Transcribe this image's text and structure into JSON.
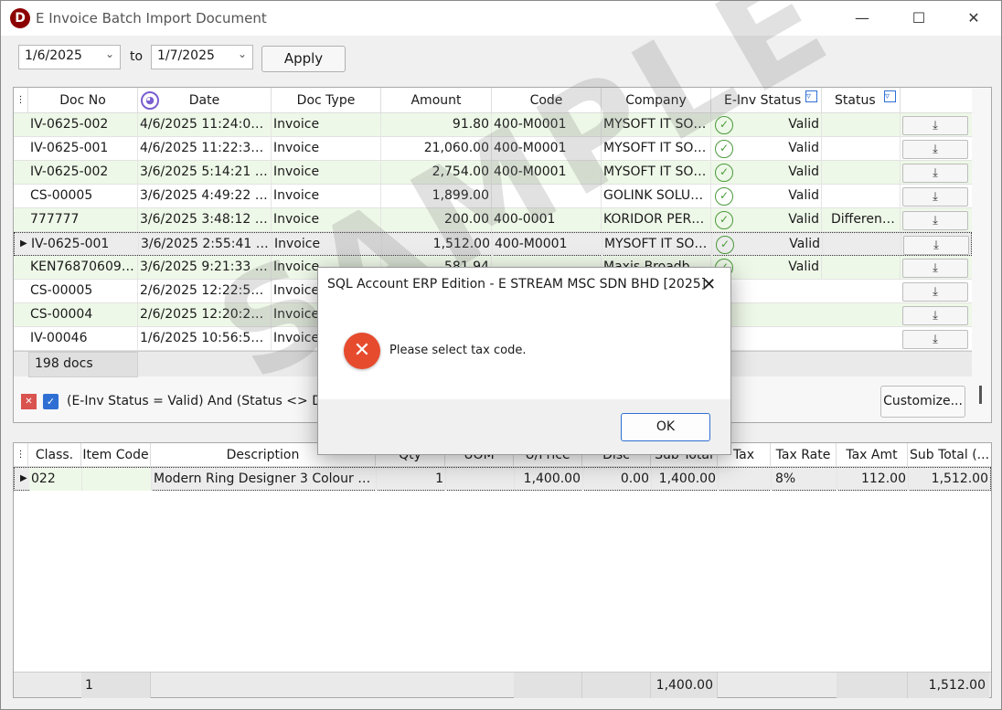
{
  "window": {
    "title": "E Invoice Batch Import Document",
    "app_letter": "D"
  },
  "toolbar": {
    "from_date": "1/6/2025",
    "to_label": "to",
    "to_date": "1/7/2025",
    "apply_label": "Apply"
  },
  "main_grid": {
    "columns": [
      "Doc No",
      "Date",
      "Doc Type",
      "Amount",
      "Code",
      "Company",
      "E-Inv Status",
      "Status"
    ],
    "rows": [
      {
        "doc_no": "IV-0625-002",
        "date": "4/6/2025 11:24:08 A...",
        "doc_type": "Invoice",
        "amount": "91.80",
        "code": "400-M0001",
        "company": "MYSOFT IT SOL...",
        "einv": "Valid",
        "status": ""
      },
      {
        "doc_no": "IV-0625-001",
        "date": "4/6/2025 11:22:32 A...",
        "doc_type": "Invoice",
        "amount": "21,060.00",
        "code": "400-M0001",
        "company": "MYSOFT IT SOL...",
        "einv": "Valid",
        "status": ""
      },
      {
        "doc_no": "IV-0625-002",
        "date": "3/6/2025 5:14:21 PM",
        "doc_type": "Invoice",
        "amount": "2,754.00",
        "code": "400-M0001",
        "company": "MYSOFT IT SOL...",
        "einv": "Valid",
        "status": ""
      },
      {
        "doc_no": "CS-00005",
        "date": "3/6/2025 4:49:22 PM",
        "doc_type": "Invoice",
        "amount": "1,899.00",
        "code": "",
        "company": "GOLINK SOLUTI...",
        "einv": "Valid",
        "status": ""
      },
      {
        "doc_no": "777777",
        "date": "3/6/2025 3:48:12 PM",
        "doc_type": "Invoice",
        "amount": "200.00",
        "code": "400-0001",
        "company": "KORIDOR PERK...",
        "einv": "Valid",
        "status": "Different ..."
      },
      {
        "doc_no": "IV-0625-001",
        "date": "3/6/2025 2:55:41 PM",
        "doc_type": "Invoice",
        "amount": "1,512.00",
        "code": "400-M0001",
        "company": "MYSOFT IT SOL...",
        "einv": "Valid",
        "status": ""
      },
      {
        "doc_no": "KEN768706098...",
        "date": "3/6/2025 9:21:33 AM",
        "doc_type": "Invoice",
        "amount": "581.94",
        "code": "",
        "company": "Maxis Broadba...",
        "einv": "Valid",
        "status": ""
      },
      {
        "doc_no": "CS-00005",
        "date": "2/6/2025 12:22:50 A...",
        "doc_type": "Invoice",
        "amount": "",
        "code": "",
        "company": "",
        "einv": "",
        "status": ""
      },
      {
        "doc_no": "CS-00004",
        "date": "2/6/2025 12:20:29 A...",
        "doc_type": "Invoice",
        "amount": "",
        "code": "",
        "company": "",
        "einv": "",
        "status": ""
      },
      {
        "doc_no": "IV-00046",
        "date": "1/6/2025 10:56:54 P...",
        "doc_type": "Invoice",
        "amount": "",
        "code": "",
        "company": "",
        "einv": "",
        "status": ""
      }
    ],
    "doc_count": "198 docs"
  },
  "filter": {
    "text": "(E-Inv Status = Valid) And (Status <> Don",
    "customize_label": "Customize..."
  },
  "detail_grid": {
    "columns": [
      "Class.",
      "Item Code",
      "Description",
      "Qty",
      "UOM",
      "U/Price",
      "Disc",
      "Sub Total",
      "Tax",
      "Tax Rate",
      "Tax Amt",
      "Sub Total (..."
    ],
    "row": {
      "class": "022",
      "item_code": "",
      "description": "Modern Ring Designer 3 Colour LE...",
      "qty": "1",
      "uom": "",
      "uprice": "1,400.00",
      "disc": "0.00",
      "subtotal": "1,400.00",
      "tax": "",
      "tax_rate": "8%",
      "tax_amt": "112.00",
      "subtotal_tax": "1,512.00"
    },
    "footer": {
      "count": "1",
      "subtotal": "1,400.00",
      "subtotal_tax": "1,512.00"
    }
  },
  "watermark": "SAMPLE",
  "dialog": {
    "title": "SQL Account ERP Edition - E STREAM MSC SDN BHD [2025]",
    "message": "Please select tax code.",
    "ok_label": "OK"
  }
}
